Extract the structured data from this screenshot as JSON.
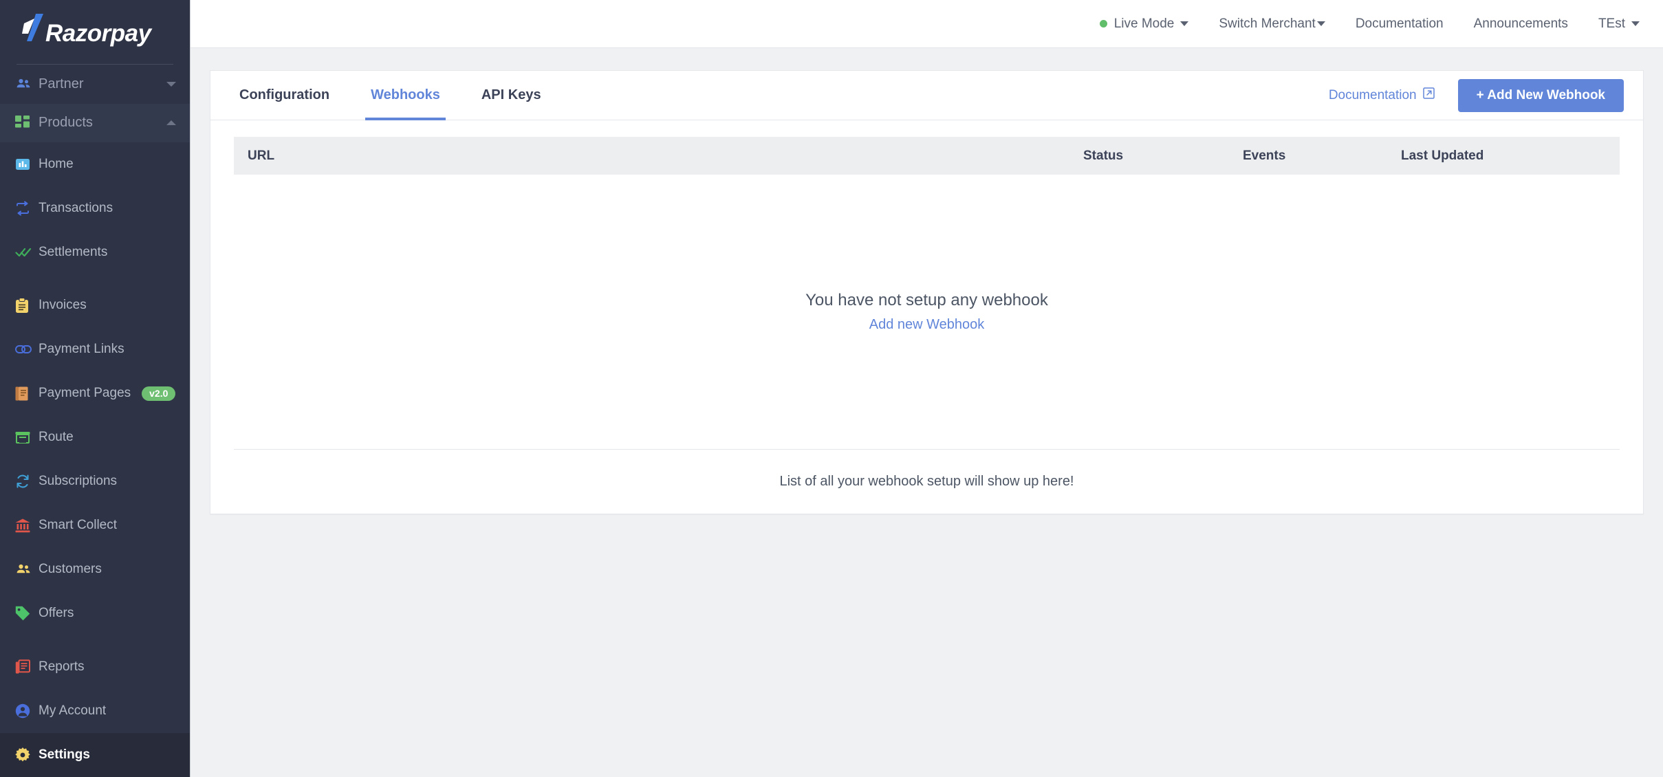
{
  "brand": {
    "name": "Razorpay",
    "logo_icon": "razorpay-logo"
  },
  "sidebar": {
    "sections": [
      {
        "label": "Partner",
        "icon": "people-icon",
        "icon_color": "#5b83d9",
        "state": "collapsed",
        "chevron": "chevron-down-icon"
      },
      {
        "label": "Products",
        "icon": "grid-icon",
        "icon_color": "#6fbf73",
        "state": "expanded",
        "chevron": "chevron-up-icon"
      }
    ],
    "items": [
      {
        "label": "Home",
        "icon": "bar-chart-icon",
        "icon_color": "#5bb8e8",
        "active": false,
        "gap_before": false,
        "badge": ""
      },
      {
        "label": "Transactions",
        "icon": "exchange-icon",
        "icon_color": "#4a6fdc",
        "active": false,
        "gap_before": false,
        "badge": ""
      },
      {
        "label": "Settlements",
        "icon": "double-check-icon",
        "icon_color": "#3fae5a",
        "active": false,
        "gap_before": false,
        "badge": ""
      },
      {
        "label": "Invoices",
        "icon": "clipboard-icon",
        "icon_color": "#f2d26b",
        "active": false,
        "gap_before": true,
        "badge": ""
      },
      {
        "label": "Payment Links",
        "icon": "link-icon",
        "icon_color": "#4a6fdc",
        "active": false,
        "gap_before": false,
        "badge": ""
      },
      {
        "label": "Payment Pages",
        "icon": "document-icon",
        "icon_color": "#e09a5c",
        "active": false,
        "gap_before": false,
        "badge": "v2.0"
      },
      {
        "label": "Route",
        "icon": "storefront-icon",
        "icon_color": "#5cc45e",
        "active": false,
        "gap_before": false,
        "badge": ""
      },
      {
        "label": "Subscriptions",
        "icon": "refresh-icon",
        "icon_color": "#3f9ed4",
        "active": false,
        "gap_before": false,
        "badge": ""
      },
      {
        "label": "Smart Collect",
        "icon": "bank-icon",
        "icon_color": "#e0564a",
        "active": false,
        "gap_before": false,
        "badge": ""
      },
      {
        "label": "Customers",
        "icon": "people-icon",
        "icon_color": "#f2d26b",
        "active": false,
        "gap_before": false,
        "badge": ""
      },
      {
        "label": "Offers",
        "icon": "tag-icon",
        "icon_color": "#4ec46a",
        "active": false,
        "gap_before": false,
        "badge": ""
      },
      {
        "label": "Reports",
        "icon": "report-icon",
        "icon_color": "#e0564a",
        "active": false,
        "gap_before": true,
        "badge": ""
      },
      {
        "label": "My Account",
        "icon": "user-circle-icon",
        "icon_color": "#4a6fdc",
        "active": false,
        "gap_before": false,
        "badge": ""
      },
      {
        "label": "Settings",
        "icon": "gear-icon",
        "icon_color": "#f2d26b",
        "active": true,
        "gap_before": false,
        "badge": ""
      }
    ]
  },
  "topnav": {
    "live_mode": "Live Mode",
    "live_dot_color": "#60bd69",
    "switch_merchant": "Switch Merchant",
    "documentation": "Documentation",
    "announcements": "Announcements",
    "user": "TEst"
  },
  "tabs": [
    {
      "label": "Configuration",
      "active": false
    },
    {
      "label": "Webhooks",
      "active": true
    },
    {
      "label": "API Keys",
      "active": false
    }
  ],
  "actions": {
    "documentation_link": "Documentation",
    "documentation_icon": "external-link-icon",
    "add_webhook_button": "+ Add New Webhook",
    "accent_color": "#6085d9"
  },
  "table": {
    "columns": [
      "URL",
      "Status",
      "Events",
      "Last Updated"
    ],
    "rows": []
  },
  "empty_state": {
    "title": "You have not setup any webhook",
    "link": "Add new Webhook"
  },
  "footer": {
    "text": "List of all your webhook setup will show up here!"
  }
}
